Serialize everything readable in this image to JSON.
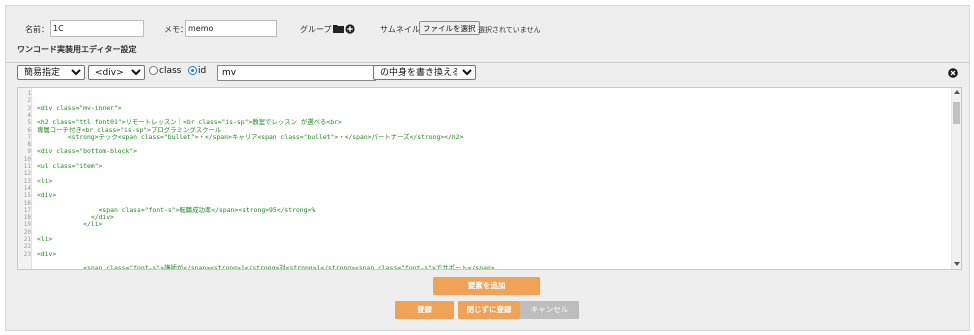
{
  "meta": {
    "name_label": "名前：",
    "name_value": "1C",
    "memo_label": "メモ：",
    "memo_value": "memo",
    "group_label": "グループ：",
    "thumbnail_label": "サムネイル：",
    "file_button": "ファイルを選択",
    "file_status": "選択されていません"
  },
  "section_title": "ワンコード実装用エディター設定",
  "toolbar": {
    "mode_select": "簡易指定",
    "tag_select": "<div>",
    "radio_class": "class",
    "radio_id": "id",
    "selector_value": "mv",
    "action_select": "の中身を書き換える"
  },
  "editor": {
    "line_numbers": [
      "1",
      "2",
      "3",
      "4",
      "5",
      "6",
      "7",
      "8",
      "9",
      "10",
      "11",
      "12",
      "13",
      "14",
      "15",
      "16",
      "17",
      "18",
      "19",
      "20",
      "21",
      "22",
      "23"
    ],
    "lines": [
      "",
      "",
      "<div class=\"mv-inner\">",
      "",
      "<h2 class=\"ttl font01\">リモートレッスン｜<br class=\"is-sp\">教室でレッスン が選べる<br>",
      "専属コーチ付き<br class=\"is-sp\">プログラミングスクール",
      "        <strong>テック<span class=\"bullet\">・</span>キャリア<span class=\"bullet\">・</span>パートナーズ</strong></h2>",
      "",
      "<div class=\"bottom-block\">",
      "",
      "<ul class=\"item\">",
      "",
      "<li>",
      "",
      "<div>",
      "",
      "                <span class=\"font-s\">転職成功率</span><strong>95</strong>%",
      "              </div>",
      "            </li>",
      "",
      "<li>",
      "",
      "<div>",
      "",
      "            <span class=\"font-s\">講師が</span><strong>1</strong>対<strong>1</strong><span class=\"font-s\">でサポート</span>"
    ]
  },
  "buttons": {
    "add_element": "要素を追加",
    "save": "登録",
    "save_no_close": "閉じずに登録",
    "cancel": "キャンセル"
  },
  "colors": {
    "accent_orange": "#f0a356",
    "code_green": "#1f8a1f",
    "radio_blue": "#1a73e8"
  }
}
